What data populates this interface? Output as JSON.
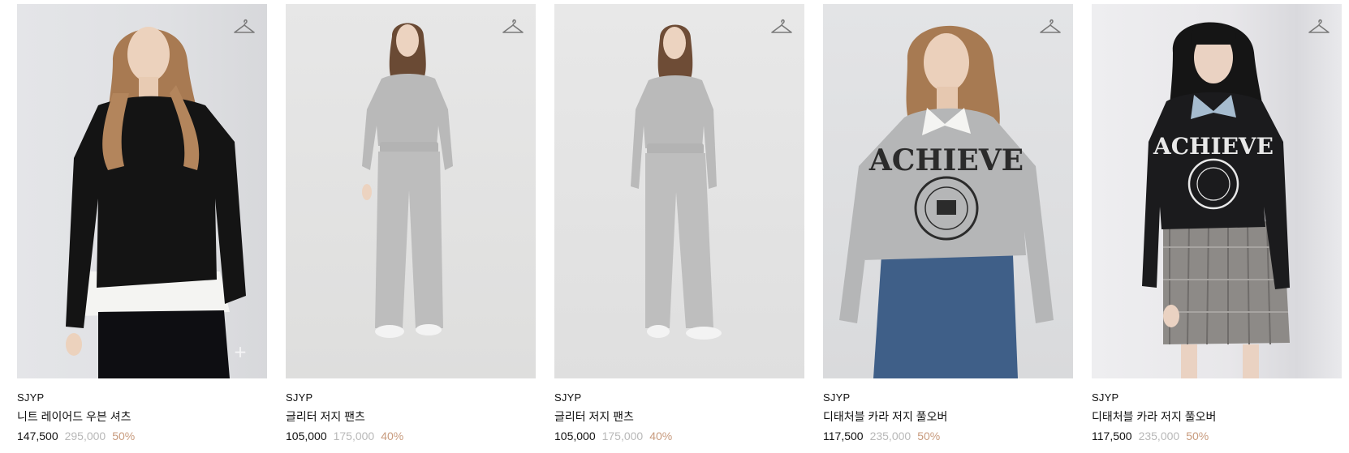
{
  "products": [
    {
      "brand": "SJYP",
      "name": "니트 레이어드 우븐 셔츠",
      "price": "147,500",
      "original_price": "295,000",
      "discount": "50%",
      "wishlist_icon": "hanger-icon",
      "quick_add_icon": "plus-icon",
      "quick_add_glyph": "+"
    },
    {
      "brand": "SJYP",
      "name": "글리터 저지 팬츠",
      "price": "105,000",
      "original_price": "175,000",
      "discount": "40%",
      "wishlist_icon": "hanger-icon"
    },
    {
      "brand": "SJYP",
      "name": "글리터 저지 팬츠",
      "price": "105,000",
      "original_price": "175,000",
      "discount": "40%",
      "wishlist_icon": "hanger-icon"
    },
    {
      "brand": "SJYP",
      "name": "디태처블 카라 저지 풀오버",
      "price": "117,500",
      "original_price": "235,000",
      "discount": "50%",
      "wishlist_icon": "hanger-icon",
      "print_text": "ACHIEVE"
    },
    {
      "brand": "SJYP",
      "name": "디태처블 카라 저지 풀오버",
      "price": "117,500",
      "original_price": "235,000",
      "discount": "50%",
      "wishlist_icon": "hanger-icon",
      "print_text": "ACHIEVE"
    }
  ],
  "colors": {
    "discount": "#c89b7e",
    "original_price": "#b8b8b8",
    "text": "#111111"
  }
}
